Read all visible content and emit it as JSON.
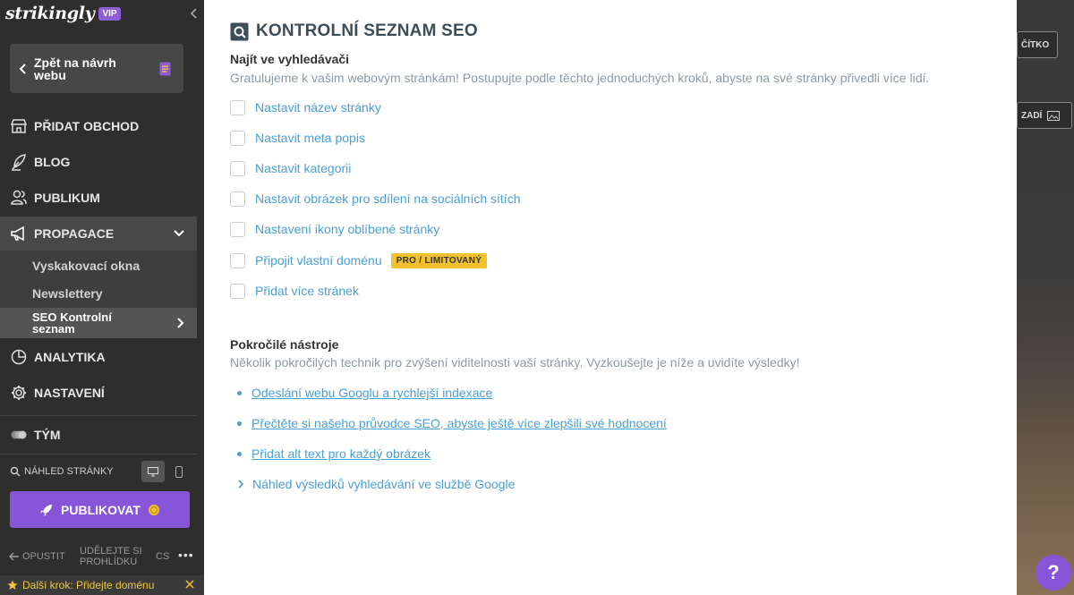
{
  "sidebar": {
    "brand": "strikingly",
    "vip_label": "VIP",
    "back_label": "Zpět na návrh webu",
    "nav": {
      "store": "PŘIDAT OBCHOD",
      "blog": "BLOG",
      "audience": "PUBLIKUM",
      "promotion": "PROPAGACE",
      "analytics": "ANALYTIKA",
      "settings": "NASTAVENÍ",
      "team": "TÝM"
    },
    "promotion_sub": {
      "popups": "Vyskakovací okna",
      "newsletters": "Newslettery",
      "seo": "SEO Kontrolní seznam"
    },
    "preview_label": "NÁHLED STRÁNKY",
    "publish_label": "PUBLIKOVAT",
    "footer": {
      "exit": "OPUSTIT",
      "tour": "UDĚLEJTE SI PROHLÍDKU",
      "lang": "CS",
      "more": "•••"
    },
    "next_step": "Další krok: Přidejte doménu"
  },
  "main": {
    "title": "KONTROLNÍ SEZNAM SEO",
    "find": {
      "heading": "Najít ve vyhledávači",
      "description": "Gratulujeme k vašim webovým stránkám! Postupujte podle těchto jednoduchých kroků, abyste na své stránky přivedli více lidí.",
      "items": [
        "Nastavit název stránky",
        "Nastavit meta popis",
        "Nastavit kategorii",
        "Nastavit obrázek pro sdílení na sociálních sítích",
        "Nastavení ikony oblíbené stránky",
        "Připojit vlastní doménu",
        "Přidat více stránek"
      ],
      "pro_badge": "PRO / LIMITOVANÝ"
    },
    "advanced": {
      "heading": "Pokročilé nástroje",
      "description": "Několik pokročilých technik pro zvýšení viditelnosti vaší stránky. Vyzkoušejte je níže a uvidíte výsledky!",
      "links": [
        "Odeslání webu Googlu a rychlejší indexace",
        "Přečtěte si našeho průvodce SEO, abyste ještě více zlepšili své hodnocení",
        "Přidat alt text pro každý obrázek"
      ],
      "expand_label": "Náhled výsledků vyhledávání ve službě Google"
    }
  },
  "preview": {
    "button_1": "ČÍTKO",
    "button_2": "ZADÍ"
  },
  "help_label": "?",
  "colors": {
    "accent_purple": "#8755d8",
    "link_blue": "#4a9fd3",
    "badge_yellow": "#f2c12e",
    "sidebar_bg": "#2e2e2e"
  }
}
